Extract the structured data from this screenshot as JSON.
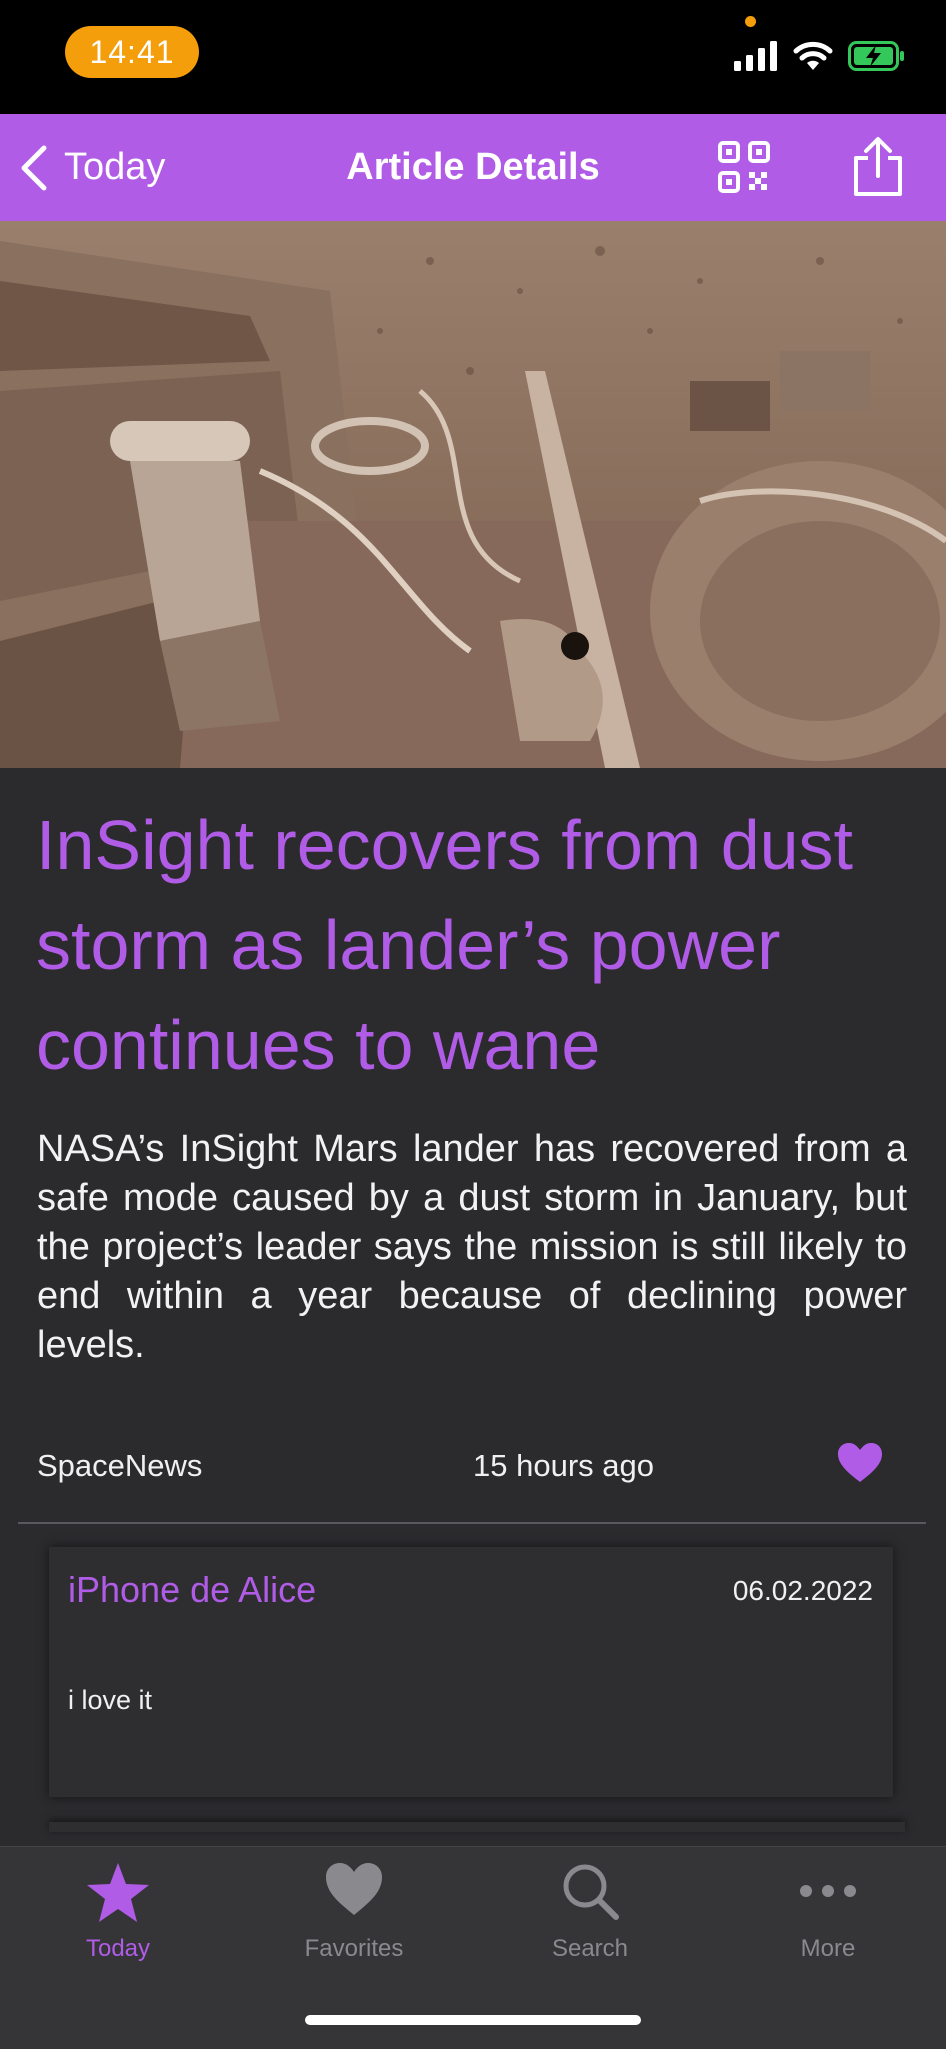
{
  "status_bar": {
    "time": "14:41"
  },
  "nav": {
    "back_label": "Today",
    "title": "Article Details",
    "qr_icon": "qr-code-icon",
    "share_icon": "share-icon"
  },
  "article": {
    "title": "InSight recovers from dust storm as lander’s power continues to wane",
    "summary": "NASA’s InSight Mars lander has recovered from a safe mode caused by a dust storm in January, but the project’s leader says the mission is still likely to end within a year because of declining power levels.",
    "source": "SpaceNews",
    "published": "15 hours ago",
    "favorite_icon": "heart-icon"
  },
  "comments": [
    {
      "author": "iPhone de Alice",
      "date": "06.02.2022",
      "text": "i love it"
    }
  ],
  "tabs": [
    {
      "label": "Today",
      "icon": "star-icon",
      "active": true
    },
    {
      "label": "Favorites",
      "icon": "heart-icon",
      "active": false
    },
    {
      "label": "Search",
      "icon": "search-icon",
      "active": false
    },
    {
      "label": "More",
      "icon": "more-icon",
      "active": false
    }
  ],
  "colors": {
    "accent": "#b05ce6",
    "background": "#2b2b2e",
    "status_pill": "#f59e0b"
  }
}
